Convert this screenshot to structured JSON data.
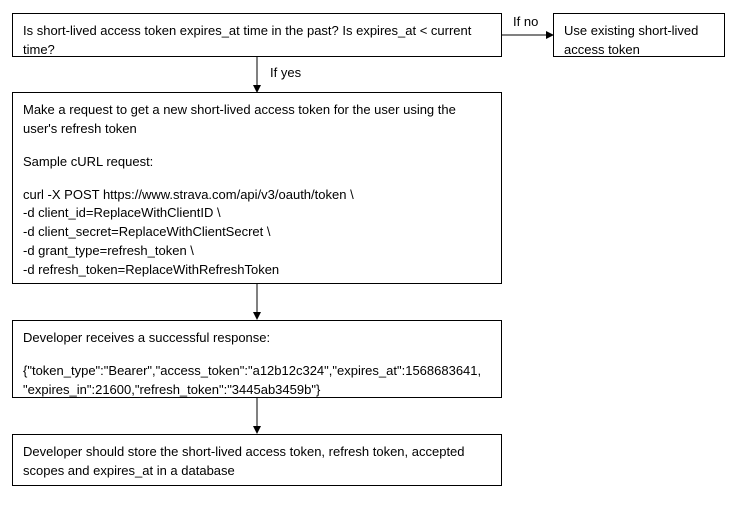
{
  "nodes": {
    "decision": "Is short-lived access token expires_at time in the past? Is expires_at < current time?",
    "use_existing": "Use existing short-lived access token",
    "request_intro": "Make a request to get a new short-lived access token for the user using the user's refresh token",
    "sample_label": "Sample cURL request:",
    "curl_line1": "curl -X POST https://www.strava.com/api/v3/oauth/token \\",
    "curl_line2": "-d client_id=ReplaceWithClientID \\",
    "curl_line3": "-d client_secret=ReplaceWithClientSecret \\",
    "curl_line4": "-d grant_type=refresh_token \\",
    "curl_line5": "-d refresh_token=ReplaceWithRefreshToken",
    "response_intro": "Developer receives a successful response:",
    "response_body": "{\"token_type\":\"Bearer\",\"access_token\":\"a12b12c324\",\"expires_at\":1568683641, \"expires_in\":21600,\"refresh_token\":\"3445ab3459b\"}",
    "store": "Developer should store the short-lived access token, refresh token, accepted scopes and expires_at in a database"
  },
  "edges": {
    "if_no": "If no",
    "if_yes": "If yes"
  }
}
